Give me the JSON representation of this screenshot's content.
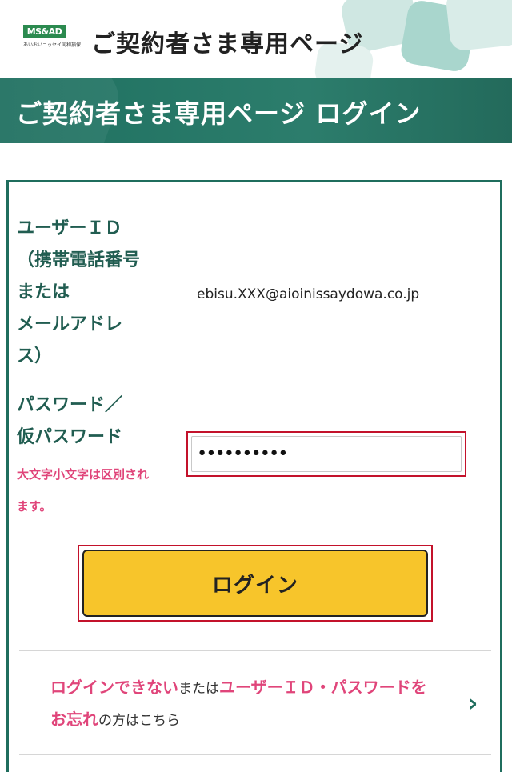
{
  "header": {
    "logo_text": "MS&AD",
    "logo_subtext": "あいおいニッセイ同和損保",
    "site_title": "ご契約者さま専用ページ"
  },
  "banner": {
    "title": "ご契約者さま専用ページ ログイン"
  },
  "form": {
    "id_label_lines": [
      "ユーザーＩＤ",
      "（携帯電話番号",
      "または",
      "メールアドレ",
      "ス）"
    ],
    "id_value": "ebisu.XXX@aioinissaydowa.co.jp",
    "pw_label_lines": [
      "パスワード／",
      "仮パスワード"
    ],
    "pw_note_lines": [
      "大文字小文字は区別され",
      "ます。"
    ],
    "pw_value": "••••••••••",
    "login_label": "ログイン"
  },
  "help": {
    "part1": "ログインできない",
    "part2": "または",
    "part3": "ユーザーＩＤ・パスワードを",
    "part4": "お忘れ",
    "part5": "の方はこちら",
    "chevron": "›"
  },
  "colors": {
    "banner": "#2c7d6c",
    "button": "#f7c52b",
    "accent_pink": "#e0457a",
    "highlight_red": "#c3122b"
  }
}
